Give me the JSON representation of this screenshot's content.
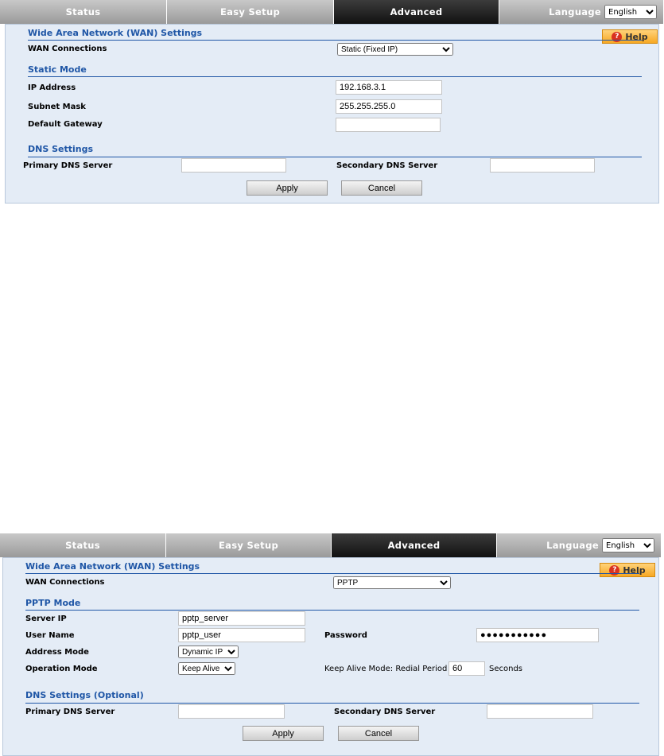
{
  "panel1": {
    "nav": {
      "status": "Status",
      "easy_setup": "Easy Setup",
      "advanced": "Advanced",
      "language_label": "Language",
      "language_value": "English"
    },
    "help_label": "Help",
    "wan_title": "Wide Area Network (WAN) Settings",
    "wan_connections_label": "WAN Connections",
    "wan_connections_value": "Static (Fixed IP)",
    "mode_title": "Static Mode",
    "ip_label": "IP Address",
    "ip_value": "192.168.3.1",
    "subnet_label": "Subnet Mask",
    "subnet_value": "255.255.255.0",
    "gateway_label": "Default Gateway",
    "gateway_value": "",
    "dns_title": "DNS Settings",
    "primary_dns_label": "Primary DNS Server",
    "primary_dns_value": "",
    "secondary_dns_label": "Secondary DNS Server",
    "secondary_dns_value": "",
    "apply": "Apply",
    "cancel": "Cancel"
  },
  "panel2": {
    "nav": {
      "status": "Status",
      "easy_setup": "Easy Setup",
      "advanced": "Advanced",
      "language_label": "Language",
      "language_value": "English"
    },
    "help_label": "Help",
    "wan_title": "Wide Area Network (WAN) Settings",
    "wan_connections_label": "WAN Connections",
    "wan_connections_value": "PPTP",
    "mode_title": "PPTP Mode",
    "server_ip_label": "Server IP",
    "server_ip_value": "pptp_server",
    "username_label": "User Name",
    "username_value": "pptp_user",
    "password_label": "Password",
    "password_value": "●●●●●●●●●●●",
    "address_mode_label": "Address Mode",
    "address_mode_value": "Dynamic IP",
    "operation_mode_label": "Operation Mode",
    "operation_mode_value": "Keep Alive",
    "keep_alive_label": "Keep Alive Mode: Redial Period",
    "redial_value": "60",
    "seconds_label": "Seconds",
    "dns_title": "DNS Settings (Optional)",
    "primary_dns_label": "Primary DNS Server",
    "primary_dns_value": "",
    "secondary_dns_label": "Secondary DNS Server",
    "secondary_dns_value": "",
    "apply": "Apply",
    "cancel": "Cancel"
  },
  "colors": {
    "accent_blue": "#1f56a6",
    "panel_bg": "#e4ecf6",
    "help_orange": "#f7a823"
  }
}
